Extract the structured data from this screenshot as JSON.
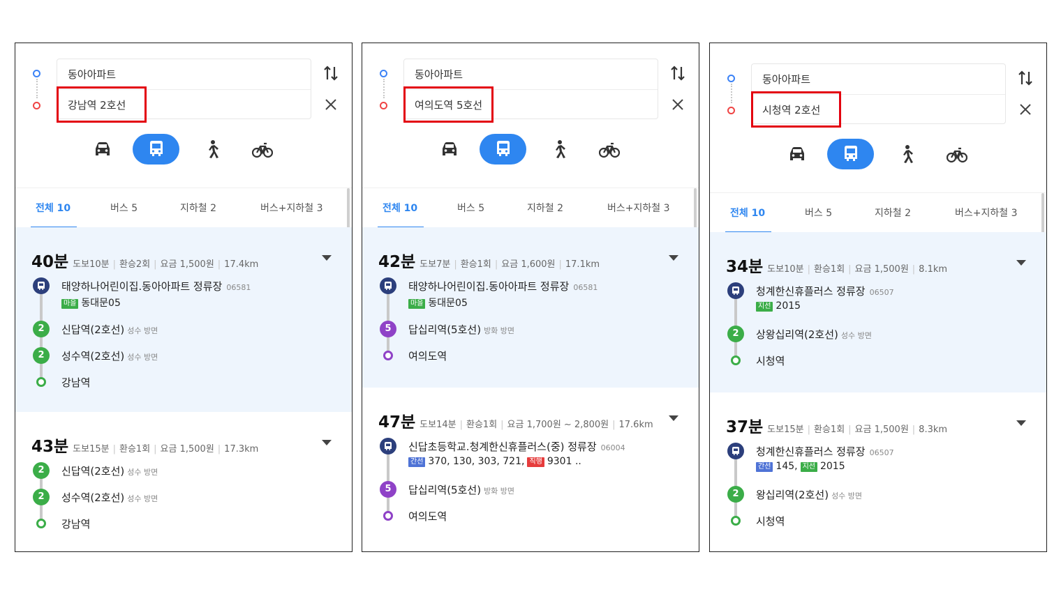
{
  "colors": {
    "accent": "#2e86f0",
    "highlight_border": "#e3000f",
    "line2": "#3bad48",
    "line5": "#8f42c7",
    "bus_stop": "#2c3f7c",
    "badge_village": "#3bad48",
    "badge_trunk": "#4f73d6",
    "badge_branch": "#3bad48",
    "badge_direct": "#e63c3c"
  },
  "panels": [
    {
      "origin": "동아아파트",
      "destination": "강남역 2호선",
      "tabs": [
        "전체 10",
        "버스 5",
        "지하철 2",
        "버스+지하철 3"
      ],
      "active_tab": 0,
      "routes": [
        {
          "time": "40분",
          "meta": [
            "도보10분",
            "환승2회",
            "요금 1,500원",
            "17.4km"
          ],
          "highlight": true,
          "steps": [
            {
              "type": "bus",
              "name": "태양하나어린이집.동아아파트 정류장",
              "code": "06581",
              "lines": [
                {
                  "badge": "마을",
                  "badge_color": "#3bad48",
                  "numbers": "동대문05"
                }
              ]
            },
            {
              "type": "subway",
              "line": "2",
              "color": "#3bad48",
              "name": "신답역(2호선)",
              "direction": "성수 방면"
            },
            {
              "type": "subway",
              "line": "2",
              "color": "#3bad48",
              "name": "성수역(2호선)",
              "direction": "성수 방면"
            },
            {
              "type": "end",
              "color": "#3bad48",
              "name": "강남역"
            }
          ]
        },
        {
          "time": "43분",
          "meta": [
            "도보15분",
            "환승1회",
            "요금 1,500원",
            "17.3km"
          ],
          "highlight": false,
          "steps": [
            {
              "type": "subway",
              "line": "2",
              "color": "#3bad48",
              "name": "신답역(2호선)",
              "direction": "성수 방면"
            },
            {
              "type": "subway",
              "line": "2",
              "color": "#3bad48",
              "name": "성수역(2호선)",
              "direction": "성수 방면"
            },
            {
              "type": "end",
              "color": "#3bad48",
              "name": "강남역"
            }
          ]
        }
      ]
    },
    {
      "origin": "동아아파트",
      "destination": "여의도역 5호선",
      "tabs": [
        "전체 10",
        "버스 5",
        "지하철 2",
        "버스+지하철 3"
      ],
      "active_tab": 0,
      "routes": [
        {
          "time": "42분",
          "meta": [
            "도보7분",
            "환승1회",
            "요금 1,600원",
            "17.1km"
          ],
          "highlight": true,
          "steps": [
            {
              "type": "bus",
              "name": "태양하나어린이집.동아아파트 정류장",
              "code": "06581",
              "lines": [
                {
                  "badge": "마을",
                  "badge_color": "#3bad48",
                  "numbers": "동대문05"
                }
              ]
            },
            {
              "type": "subway",
              "line": "5",
              "color": "#8f42c7",
              "name": "답십리역(5호선)",
              "direction": "방화 방면"
            },
            {
              "type": "end",
              "color": "#8f42c7",
              "name": "여의도역"
            }
          ]
        },
        {
          "time": "47분",
          "meta": [
            "도보14분",
            "환승1회",
            "요금 1,700원 ~ 2,800원",
            "17.6km"
          ],
          "highlight": false,
          "steps": [
            {
              "type": "bus",
              "name": "신답초등학교.청계한신휴플러스(중) 정류장",
              "code": "06004",
              "lines": [
                {
                  "badge": "간선",
                  "badge_color": "#4f73d6",
                  "numbers": "370, 130, 303, 721,"
                },
                {
                  "badge": "직행",
                  "badge_color": "#e63c3c",
                  "numbers": "9301 .."
                }
              ]
            },
            {
              "type": "subway",
              "line": "5",
              "color": "#8f42c7",
              "name": "답십리역(5호선)",
              "direction": "방화 방면"
            },
            {
              "type": "end",
              "color": "#8f42c7",
              "name": "여의도역"
            }
          ]
        }
      ]
    },
    {
      "origin": "동아아파트",
      "destination": "시청역 2호선",
      "tabs": [
        "전체 10",
        "버스 5",
        "지하철 2",
        "버스+지하철 3"
      ],
      "active_tab": 0,
      "routes": [
        {
          "time": "34분",
          "meta": [
            "도보10분",
            "환승1회",
            "요금 1,500원",
            "8.1km"
          ],
          "highlight": true,
          "steps": [
            {
              "type": "bus",
              "name": "청계한신휴플러스 정류장",
              "code": "06507",
              "lines": [
                {
                  "badge": "지선",
                  "badge_color": "#3bad48",
                  "numbers": "2015"
                }
              ]
            },
            {
              "type": "subway",
              "line": "2",
              "color": "#3bad48",
              "name": "상왕십리역(2호선)",
              "direction": "성수 방면"
            },
            {
              "type": "end",
              "color": "#3bad48",
              "name": "시청역"
            }
          ]
        },
        {
          "time": "37분",
          "meta": [
            "도보15분",
            "환승1회",
            "요금 1,500원",
            "8.3km"
          ],
          "highlight": false,
          "steps": [
            {
              "type": "bus",
              "name": "청계한신휴플러스 정류장",
              "code": "06507",
              "lines": [
                {
                  "badge": "간선",
                  "badge_color": "#4f73d6",
                  "numbers": "145,"
                },
                {
                  "badge": "지선",
                  "badge_color": "#3bad48",
                  "numbers": "2015"
                }
              ]
            },
            {
              "type": "subway",
              "line": "2",
              "color": "#3bad48",
              "name": "왕십리역(2호선)",
              "direction": "성수 방면"
            },
            {
              "type": "end",
              "color": "#3bad48",
              "name": "시청역"
            }
          ]
        }
      ]
    }
  ]
}
